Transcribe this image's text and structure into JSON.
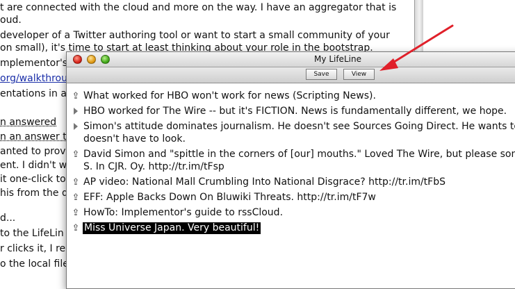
{
  "background_document": {
    "lines": [
      {
        "text": "t are connected with the cloud and more on the way. I have an aggregator that is"
      },
      {
        "text": "oud."
      },
      {
        "text": "developer of a Twitter authoring tool or want to start a small community of your"
      },
      {
        "text": "on small), it's time to start at least thinking about your role in the bootstrap."
      },
      {
        "text": "mplementor's"
      },
      {
        "text": "org/walkthrou"
      },
      {
        "text": "entations in al"
      },
      {
        "text": "n answered"
      },
      {
        "text": "n an answer t"
      },
      {
        "text": "anted to provi"
      },
      {
        "text": "ent. I didn't wa"
      },
      {
        "text": "it one-click to"
      },
      {
        "text": "his from the da"
      },
      {
        "text": "d..."
      },
      {
        "text": " to the LifeLin"
      },
      {
        "text": "r clicks it, I re"
      },
      {
        "text": "o the local file"
      }
    ]
  },
  "window": {
    "title": "My LifeLine",
    "toolbar": {
      "save_label": "Save",
      "view_label": "View"
    }
  },
  "outline": {
    "items": [
      {
        "marker": "up-arrow",
        "lines": [
          "What worked for HBO won't work for news (Scripting News)."
        ]
      },
      {
        "marker": "triangle",
        "lines": [
          "HBO worked for The Wire -- but it's FICTION. News is fundamentally different, we hope."
        ]
      },
      {
        "marker": "triangle",
        "lines": [
          "Simon's attitude dominates journalism. He doesn't see Sources Going Direct. He wants to",
          "doesn't have to look."
        ]
      },
      {
        "marker": "up-arrow",
        "lines": [
          "David Simon and \"spittle in the corners of [our] mouths.\" Loved The Wire, but please som",
          "S. In CJR. Oy. http://tr.im/tFsp"
        ]
      },
      {
        "marker": "up-arrow",
        "lines": [
          "AP video: National Mall Crumbling Into National Disgrace? http://tr.im/tFbS"
        ]
      },
      {
        "marker": "up-arrow",
        "lines": [
          "EFF: Apple Backs Down On Bluwiki Threats. http://tr.im/tF7w"
        ]
      },
      {
        "marker": "up-arrow",
        "lines": [
          "HowTo: Implementor's guide to rssCloud."
        ]
      },
      {
        "marker": "up-arrow",
        "lines": [
          "Miss Universe Japan. Very beautiful!"
        ],
        "selected": true
      }
    ]
  },
  "colors": {
    "annotation_arrow": "#e0202a",
    "selection": "#000000"
  }
}
